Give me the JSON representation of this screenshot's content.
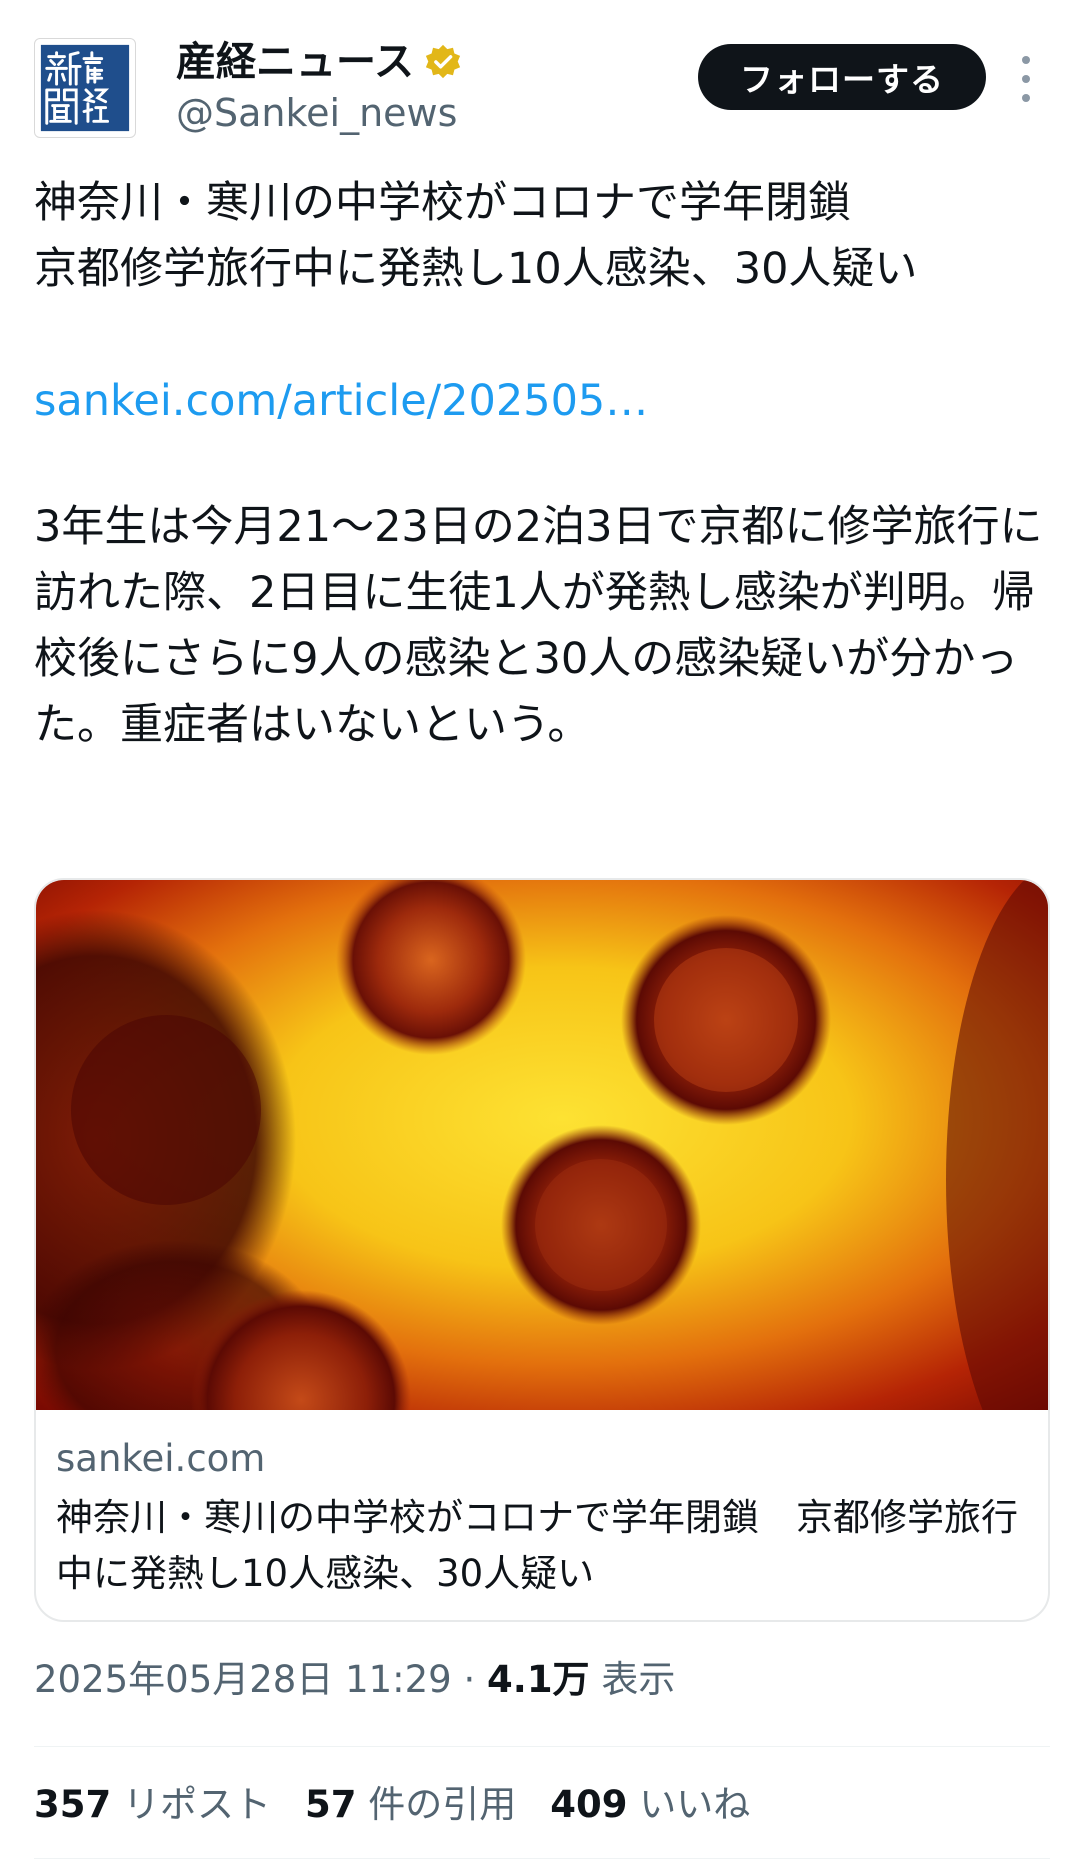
{
  "account": {
    "display_name": "産経ニュース",
    "handle": "@Sankei_news",
    "logo_text": "産経新聞",
    "verified_icon": "verified-badge-gold-icon",
    "follow_label": "フォローする",
    "more_icon": "more-vertical-icon"
  },
  "tweet": {
    "headline": "神奈川・寒川の中学校がコロナで学年閉鎖\n京都修学旅行中に発熱し10人感染、30人疑い",
    "link": "sankei.com/article/202505…",
    "body": "3年生は今月21〜23日の2泊3日で京都に修学旅行に訪れた際、2日目に生徒1人が発熱し感染が判明。帰校後にさらに9人の感染と30人の感染疑いが分かった。重症者はいないという。"
  },
  "card": {
    "domain": "sankei.com",
    "title": "神奈川・寒川の中学校がコロナで学年閉鎖　京都修学旅行中に発熱し10人感染、30人疑い"
  },
  "meta": {
    "datetime": "2025年05月28日 11:29",
    "separator": " · ",
    "views": "4.1万",
    "views_label": "表示"
  },
  "stats": {
    "reposts": "357",
    "reposts_label": "リポスト",
    "quotes": "57",
    "quotes_label": "件の引用",
    "likes": "409",
    "likes_label": "いいね"
  },
  "colors": {
    "text": "#0f1419",
    "secondary": "#536471",
    "link": "#1d9bf0",
    "logo_blue": "#1f4e8c",
    "verified_gold": "#e2b719"
  }
}
